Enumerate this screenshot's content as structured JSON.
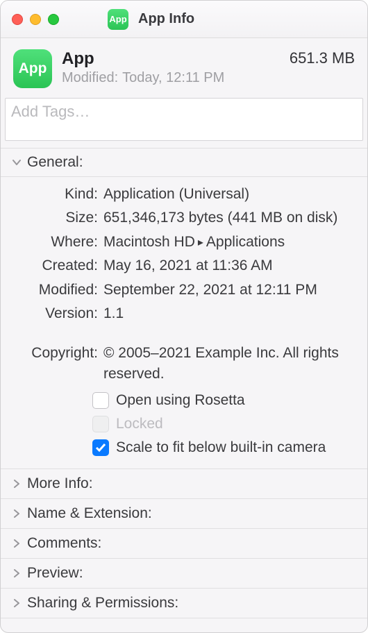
{
  "window": {
    "title": "App Info"
  },
  "header": {
    "app_name": "App",
    "modified_label": "Modified:",
    "modified_value": "Today, 12:11 PM",
    "size": "651.3 MB"
  },
  "tags": {
    "placeholder": "Add Tags…"
  },
  "sections": {
    "general_label": "General:",
    "more_info_label": "More Info:",
    "name_ext_label": "Name & Extension:",
    "comments_label": "Comments:",
    "preview_label": "Preview:",
    "sharing_label": "Sharing & Permissions:"
  },
  "general": {
    "kind_label": "Kind:",
    "kind_value": "Application (Universal)",
    "size_label": "Size:",
    "size_value": "651,346,173 bytes (441 MB on disk)",
    "where_label": "Where:",
    "where_value_a": "Macintosh HD",
    "where_value_b": "Applications",
    "created_label": "Created:",
    "created_value": "May 16, 2021 at 11:36 AM",
    "modified_label": "Modified:",
    "modified_value": "September 22, 2021 at 12:11 PM",
    "version_label": "Version:",
    "version_value": "1.1",
    "copyright_label": "Copyright:",
    "copyright_value": "© 2005–2021 Example Inc. All rights reserved."
  },
  "checks": {
    "rosetta_label": "Open using Rosetta",
    "locked_label": "Locked",
    "scale_label": "Scale to fit below built-in camera"
  }
}
